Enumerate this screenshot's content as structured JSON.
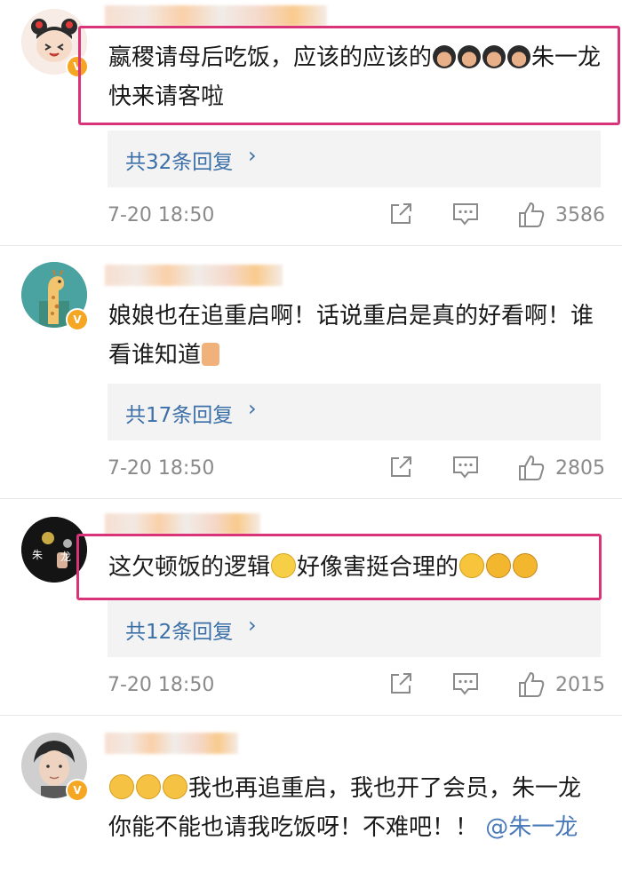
{
  "comments": [
    {
      "text": "嬴稷请母后吃饭，应该的应该的",
      "text_after": "朱一龙快来请客啦",
      "replies_label": "共32条回复",
      "time": "7-20 18:50",
      "likes": "3586"
    },
    {
      "text": "娘娘也在追重启啊！话说重启是真的好看啊！谁看谁知道",
      "replies_label": "共17条回复",
      "time": "7-20 18:50",
      "likes": "2805"
    },
    {
      "text_before": "这欠顿饭的逻辑",
      "text_after": "好像害挺合理的",
      "replies_label": "共12条回复",
      "time": "7-20 18:50",
      "likes": "2015"
    },
    {
      "text": "我也再追重启，我也开了会员，朱一龙你能不能也请我吃饭呀！不难吧！！",
      "mention": "@朱一龙"
    }
  ],
  "avatar_text": {
    "c3_line1": "朱",
    "c3_line2": "龙"
  },
  "icons": {
    "share": "share-icon",
    "comment": "comment-icon",
    "like": "like-icon",
    "verified": "verified-badge-icon"
  },
  "colors": {
    "highlight": "#d9347a",
    "link": "#3b6fa8",
    "badge": "#f5a623"
  }
}
